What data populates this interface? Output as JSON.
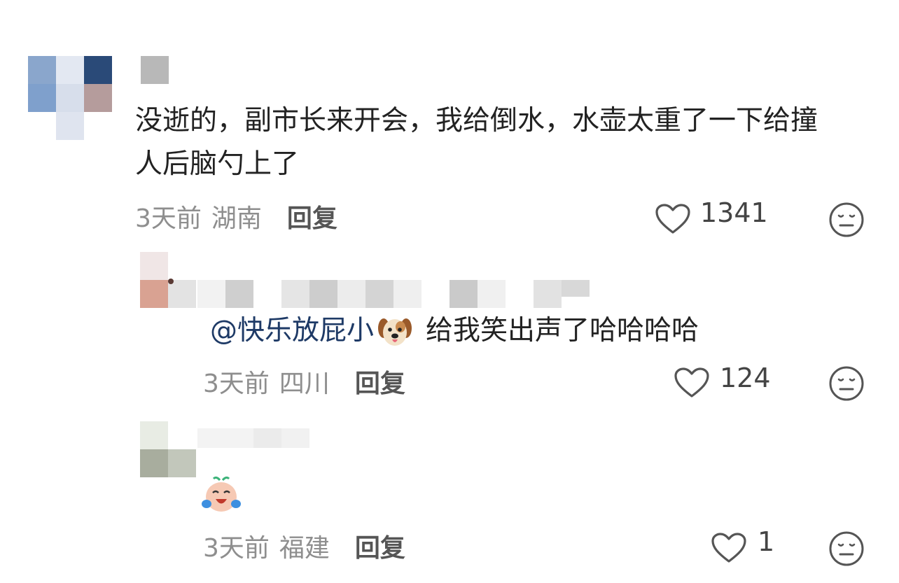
{
  "comments": [
    {
      "text": "没逝的，副市长来开会，我给倒水，水壶太重了一下给撞人后脑勺上了",
      "time": "3天前",
      "location": "湖南",
      "reply_label": "回复",
      "likes": "1341"
    },
    {
      "mention": "@快乐放屁小",
      "emoji": "dog-face",
      "text": "给我笑出声了哈哈哈哈",
      "time": "3天前",
      "location": "四川",
      "reply_label": "回复",
      "likes": "124"
    },
    {
      "emoji": "crying-laughing-baby",
      "time": "3天前",
      "location": "福建",
      "reply_label": "回复",
      "likes": "1"
    }
  ],
  "icons": {
    "like": "heart-outline-icon",
    "reaction": "neutral-face-icon"
  },
  "colors": {
    "text": "#222222",
    "meta": "#8e8e8e",
    "mention": "#1e3a66",
    "icon": "#555555"
  }
}
